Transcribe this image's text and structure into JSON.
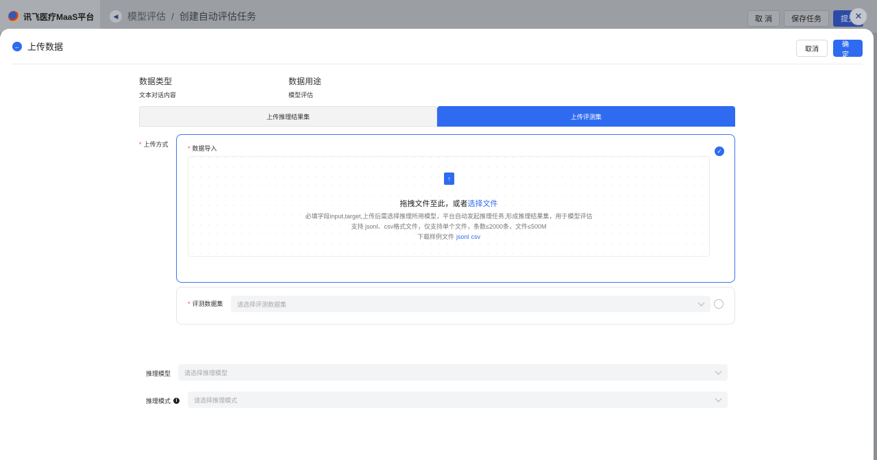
{
  "background": {
    "app_name": "讯飞医疗MaaS平台",
    "breadcrumb": [
      "模型评估",
      "创建自动评估任务"
    ],
    "separator": "/",
    "buttons": {
      "cancel": "取 消",
      "save": "保存任务",
      "submit": "提交"
    }
  },
  "drawer": {
    "title": "上传数据",
    "buttons": {
      "cancel": "取消",
      "confirm": "确定"
    },
    "meta": {
      "data_type_label": "数据类型",
      "data_type_value": "文本对话内容",
      "data_use_label": "数据用途",
      "data_use_value": "模型评估"
    },
    "tabs": [
      {
        "label": "上传推理结果集",
        "active": false
      },
      {
        "label": "上传评测集",
        "active": true
      }
    ],
    "upload_method_label": "上传方式",
    "option_import": {
      "label": "数据导入",
      "selected": true,
      "dropzone": {
        "main_text": "拖拽文件至此，或者",
        "main_link": "选择文件",
        "hint1": "必填字段input,target,上传后需选择推理所用模型，平台自动发起推理任务,形成推理结果集，用于模型评估",
        "hint2": "支持 jsonl、csv格式文件，仅支持单个文件，条数≤2000条，文件≤500M",
        "hint3": "下载样例文件",
        "sample_links": [
          "jsonl",
          "csv"
        ]
      }
    },
    "option_dataset": {
      "label": "评测数据集",
      "placeholder": "请选择评测数据集",
      "selected": false
    },
    "inference_model": {
      "label": "推理模型",
      "placeholder": "请选择推理模型"
    },
    "inference_mode": {
      "label": "推理模式",
      "placeholder": "请选择推理模式"
    }
  },
  "colors": {
    "primary": "#2e6bf0",
    "required": "#e34d4d"
  }
}
